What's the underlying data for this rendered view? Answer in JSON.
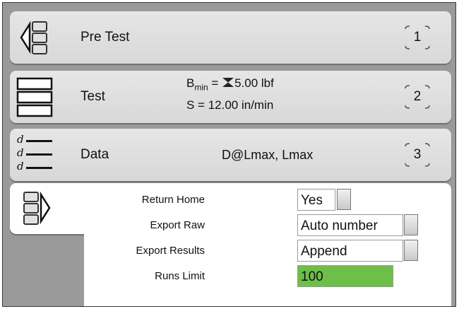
{
  "rows": [
    {
      "label": "Pre Test",
      "number": "1"
    },
    {
      "label": "Test",
      "number": "2",
      "bmin_prefix": "B",
      "bmin_sub": "min",
      "bmin_eq": " = ",
      "bmin_value": "5.00 lbf",
      "speed": "S = 12.00 in/min"
    },
    {
      "label": "Data",
      "number": "3",
      "info": "D@Lmax, Lmax"
    }
  ],
  "data_icon_letter": "d",
  "options": {
    "return_home": {
      "label": "Return Home",
      "value": "Yes"
    },
    "export_raw": {
      "label": "Export Raw",
      "value": "Auto number"
    },
    "export_results": {
      "label": "Export Results",
      "value": "Append"
    },
    "runs_limit": {
      "label": "Runs Limit",
      "value": "100"
    }
  },
  "colors": {
    "background": "#9a9a9a",
    "panel": "#e0e0e0",
    "runs_limit_fill": "#6dbf4a"
  }
}
